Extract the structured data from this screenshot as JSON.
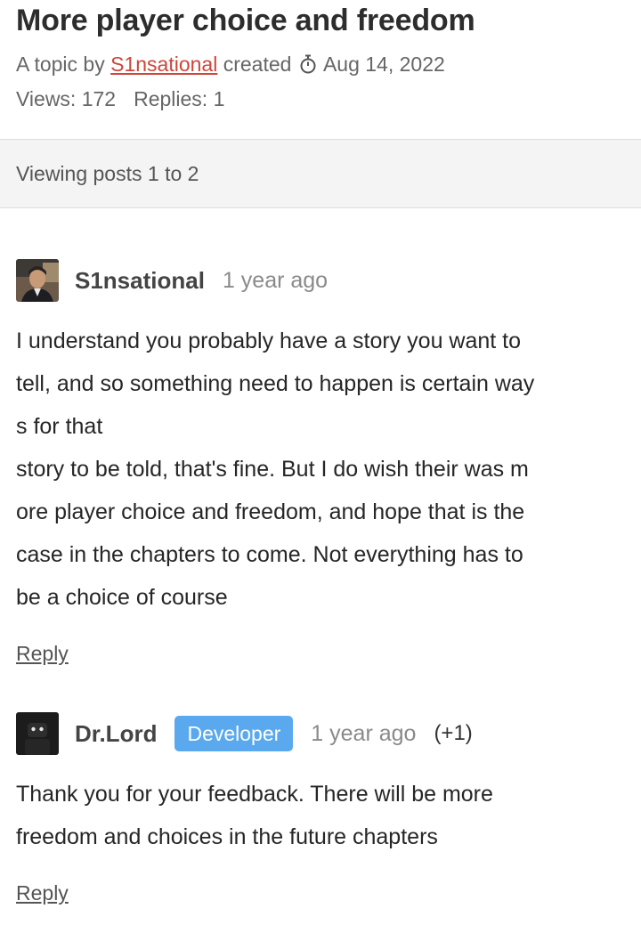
{
  "topic": {
    "title": "More player choice and freedom",
    "meta_prefix": "A topic by",
    "author": "S1nsational",
    "created_label": "created",
    "date": "Aug 14, 2022",
    "views_label": "Views: 172",
    "replies_label": "Replies: 1"
  },
  "viewing": "Viewing posts 1 to 2",
  "posts": [
    {
      "author": "S1nsational",
      "time": "1 year ago",
      "lines": [
        "I understand you probably have a story you want to",
        "tell, and so something need to happen is certain way",
        "s for that",
        "story to be told, that's fine. But I do wish their was m",
        "ore player choice and freedom, and hope that is the",
        "case in the chapters to come. Not everything has to",
        "be a choice of course"
      ],
      "reply": "Reply"
    },
    {
      "author": "Dr.Lord",
      "badge": "Developer",
      "time": "1 year ago",
      "votes": "(+1)",
      "lines": [
        "Thank you for your feedback. There will be more",
        "freedom and choices in the future chapters"
      ],
      "reply": "Reply"
    }
  ],
  "colors": {
    "link": "#d0443a",
    "badge": "#5aa9ee",
    "viewing_bar": "#f4f4f4"
  },
  "icons": {
    "created": "stopwatch-icon",
    "avatar_1": "user-photo-avatar",
    "avatar_2": "dark-robot-avatar"
  }
}
